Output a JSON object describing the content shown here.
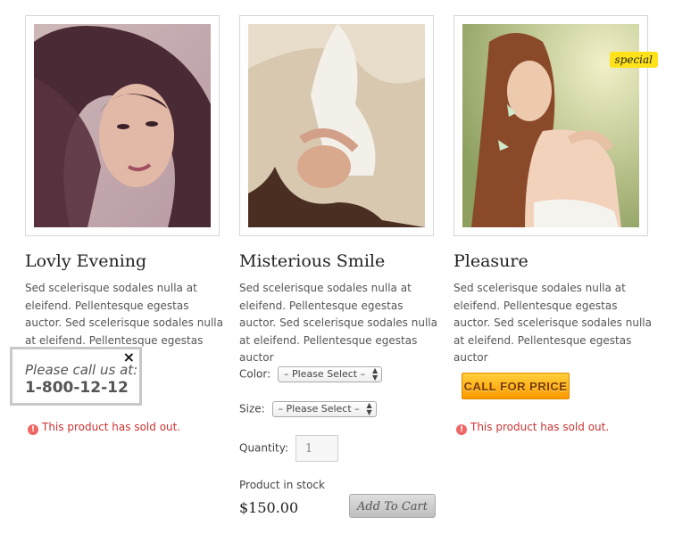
{
  "products": [
    {
      "title": "Lovly Evening",
      "description": "Sed scelerisque sodales nulla at eleifend. Pellentesque egestas auctor. Sed scelerisque sodales nulla at eleifend. Pellentesque egestas auctor",
      "sold_out_text": "This product has sold out."
    },
    {
      "title": "Misterious Smile",
      "description": "Sed scelerisque sodales nulla at eleifend. Pellentesque egestas auctor. Sed scelerisque sodales nulla at eleifend. Pellentesque egestas auctor",
      "color_label": "Color:",
      "color_value": "– Please Select –",
      "size_label": "Size:",
      "size_value": "– Please Select –",
      "quantity_label": "Quantity:",
      "quantity_value": "1",
      "stock_text": "Product in stock",
      "price": "$150.00",
      "add_to_cart_label": "Add To Cart"
    },
    {
      "title": "Pleasure",
      "description": "Sed scelerisque sodales nulla at eleifend. Pellentesque egestas auctor. Sed scelerisque sodales nulla at eleifend. Pellentesque egestas auctor",
      "badge": "special",
      "call_button_label": "CALL FOR PRICE",
      "sold_out_text": "This product has sold out."
    }
  ],
  "popup": {
    "line1": "Please call us at:",
    "phone": "1-800-12-12",
    "close_glyph": "×"
  },
  "icons": {
    "warning": "warning-icon",
    "close": "close-icon",
    "select_arrows": "select-arrows-icon"
  },
  "colors": {
    "badge": "#ffe21a",
    "call_button": "#ffb000",
    "sold_out": "#cc3333"
  }
}
